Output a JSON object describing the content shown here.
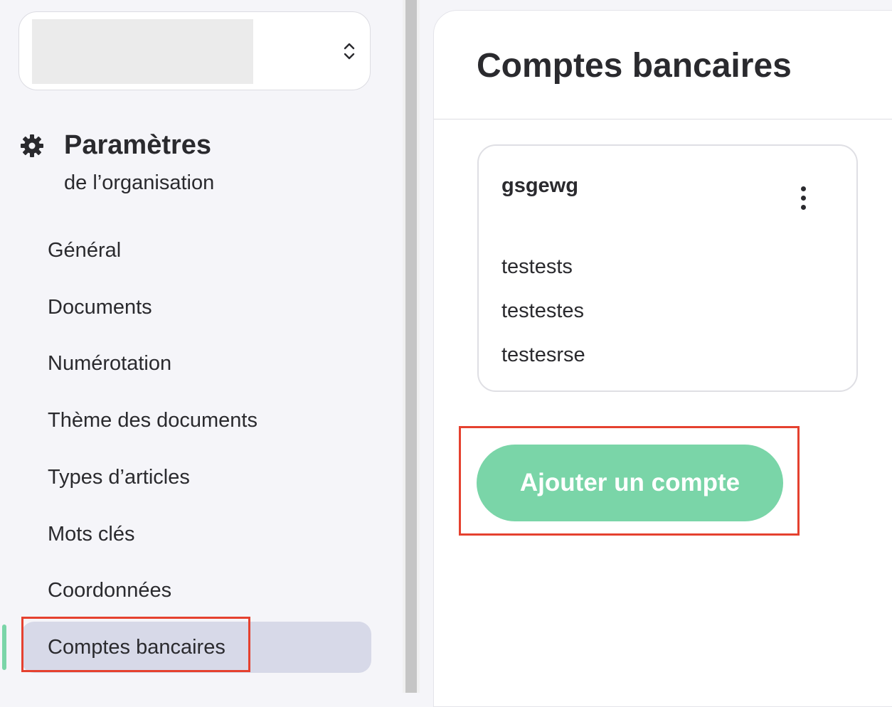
{
  "sidebar": {
    "section_title": "Paramètres",
    "section_subtitle": "de l’organisation",
    "items": [
      {
        "label": "Général"
      },
      {
        "label": "Documents"
      },
      {
        "label": "Numérotation"
      },
      {
        "label": "Thème des documents"
      },
      {
        "label": "Types d’articles"
      },
      {
        "label": "Mots clés"
      },
      {
        "label": "Coordonnées"
      },
      {
        "label": "Comptes bancaires",
        "active": true
      }
    ]
  },
  "main": {
    "title": "Comptes bancaires",
    "account": {
      "name": "gsgewg",
      "lines": [
        "testests",
        "testestes",
        "testesrse"
      ]
    },
    "add_button_label": "Ajouter un compte"
  },
  "colors": {
    "accent": "#7ad5a8",
    "active_bg": "#d7d9e8",
    "highlight": "#e5412f"
  },
  "icons": [
    "chevron-up-down-icon",
    "gear-icon",
    "more-vertical-icon"
  ]
}
